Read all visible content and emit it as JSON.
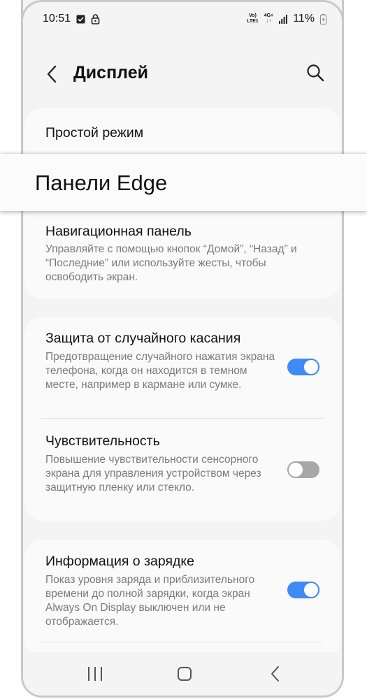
{
  "status_bar": {
    "time": "10:51",
    "network_top": "Vo)",
    "network_bottom": "LTE1",
    "data_top": "4G+",
    "battery_percent": "11%"
  },
  "app_bar": {
    "title": "Дисплей",
    "icons": [
      "back-arrow-icon",
      "search-icon"
    ]
  },
  "overlay": {
    "label": "Панели Edge"
  },
  "settings": {
    "simple_mode": {
      "title": "Простой режим"
    },
    "navigation_bar": {
      "title": "Навигационная панель",
      "description": "Управляйте с помощью кнопок “Домой”, “Назад” и “Последние” или используйте жесты, чтобы освободить экран."
    },
    "accidental_touch": {
      "title": "Защита от случайного касания",
      "description": "Предотвращение случайного нажатия экрана телефона, когда он находится в темном месте, например в кармане или сумке.",
      "enabled": true
    },
    "touch_sensitivity": {
      "title": "Чувствительность",
      "description": "Повышение чувствительности сенсорного экрана для управления устройством через защитную пленку или стекло.",
      "enabled": false
    },
    "charging_info": {
      "title": "Информация о зарядке",
      "description": "Показ уровня заряда и приблизительного времени до полной зарядки, когда экран Always On Display выключен или не отображается.",
      "enabled": true
    }
  },
  "colors": {
    "accent": "#3e8bf4",
    "toggle_off": "#a7a7a7",
    "background": "#f4f4f4",
    "card": "#fafafa"
  },
  "nav_bar": {
    "icons": [
      "recent-apps-icon",
      "home-icon",
      "back-icon"
    ]
  }
}
